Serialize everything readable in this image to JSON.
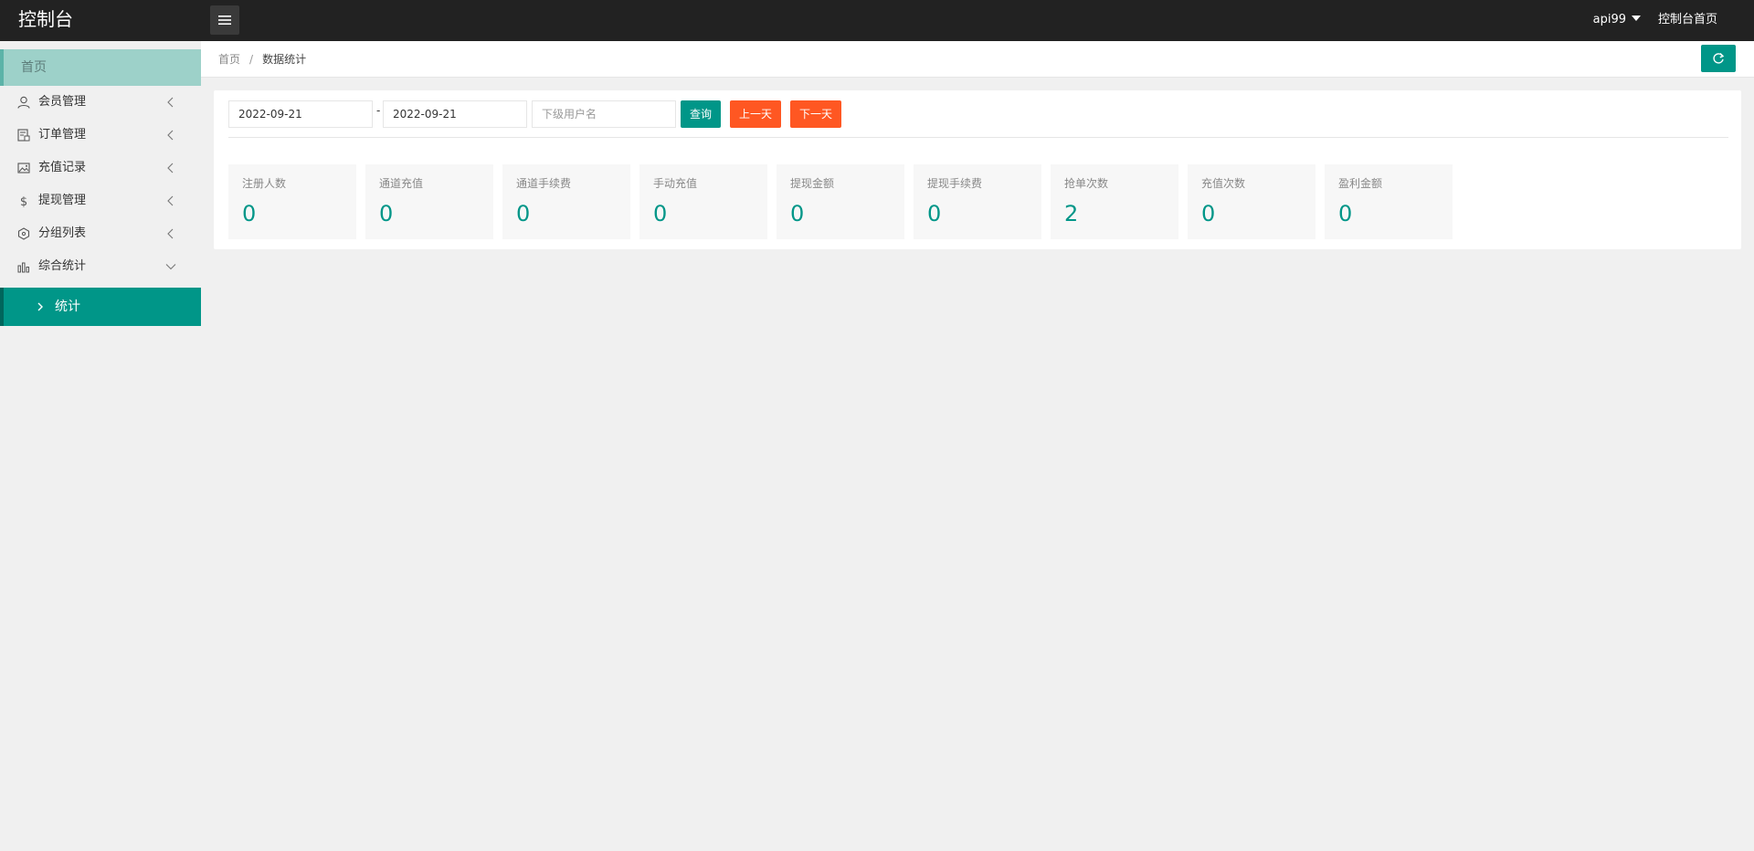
{
  "header": {
    "title": "控制台",
    "menu_toggle_icon": "hamburger-icon",
    "user": "api99",
    "home_link": "控制台首页"
  },
  "sidebar": {
    "home": "首页",
    "items": [
      {
        "label": "会员管理",
        "icon": "user-icon"
      },
      {
        "label": "订单管理",
        "icon": "order-icon"
      },
      {
        "label": "充值记录",
        "icon": "image-icon"
      },
      {
        "label": "提现管理",
        "icon": "dollar-icon"
      },
      {
        "label": "分组列表",
        "icon": "group-icon"
      },
      {
        "label": "综合统计",
        "icon": "chart-icon",
        "expanded": true
      }
    ],
    "active_sub": "统计"
  },
  "breadcrumb": {
    "home": "首页",
    "separator": "/",
    "current": "数据统计"
  },
  "filters": {
    "start_date": "2022-09-21",
    "separator": "-",
    "end_date": "2022-09-21",
    "user_placeholder": "下级用户名",
    "query_label": "查询",
    "prev_label": "上一天",
    "next_label": "下一天"
  },
  "stats": [
    {
      "label": "注册人数",
      "value": "0"
    },
    {
      "label": "通道充值",
      "value": "0"
    },
    {
      "label": "通道手续费",
      "value": "0"
    },
    {
      "label": "手动充值",
      "value": "0"
    },
    {
      "label": "提现金额",
      "value": "0"
    },
    {
      "label": "提现手续费",
      "value": "0"
    },
    {
      "label": "抢单次数",
      "value": "2"
    },
    {
      "label": "充值次数",
      "value": "0"
    },
    {
      "label": "盈利金额",
      "value": "0"
    }
  ],
  "colors": {
    "header_bg": "#222222",
    "accent": "#009688",
    "warning": "#ff5722",
    "home_highlight": "#9dd1c9"
  }
}
